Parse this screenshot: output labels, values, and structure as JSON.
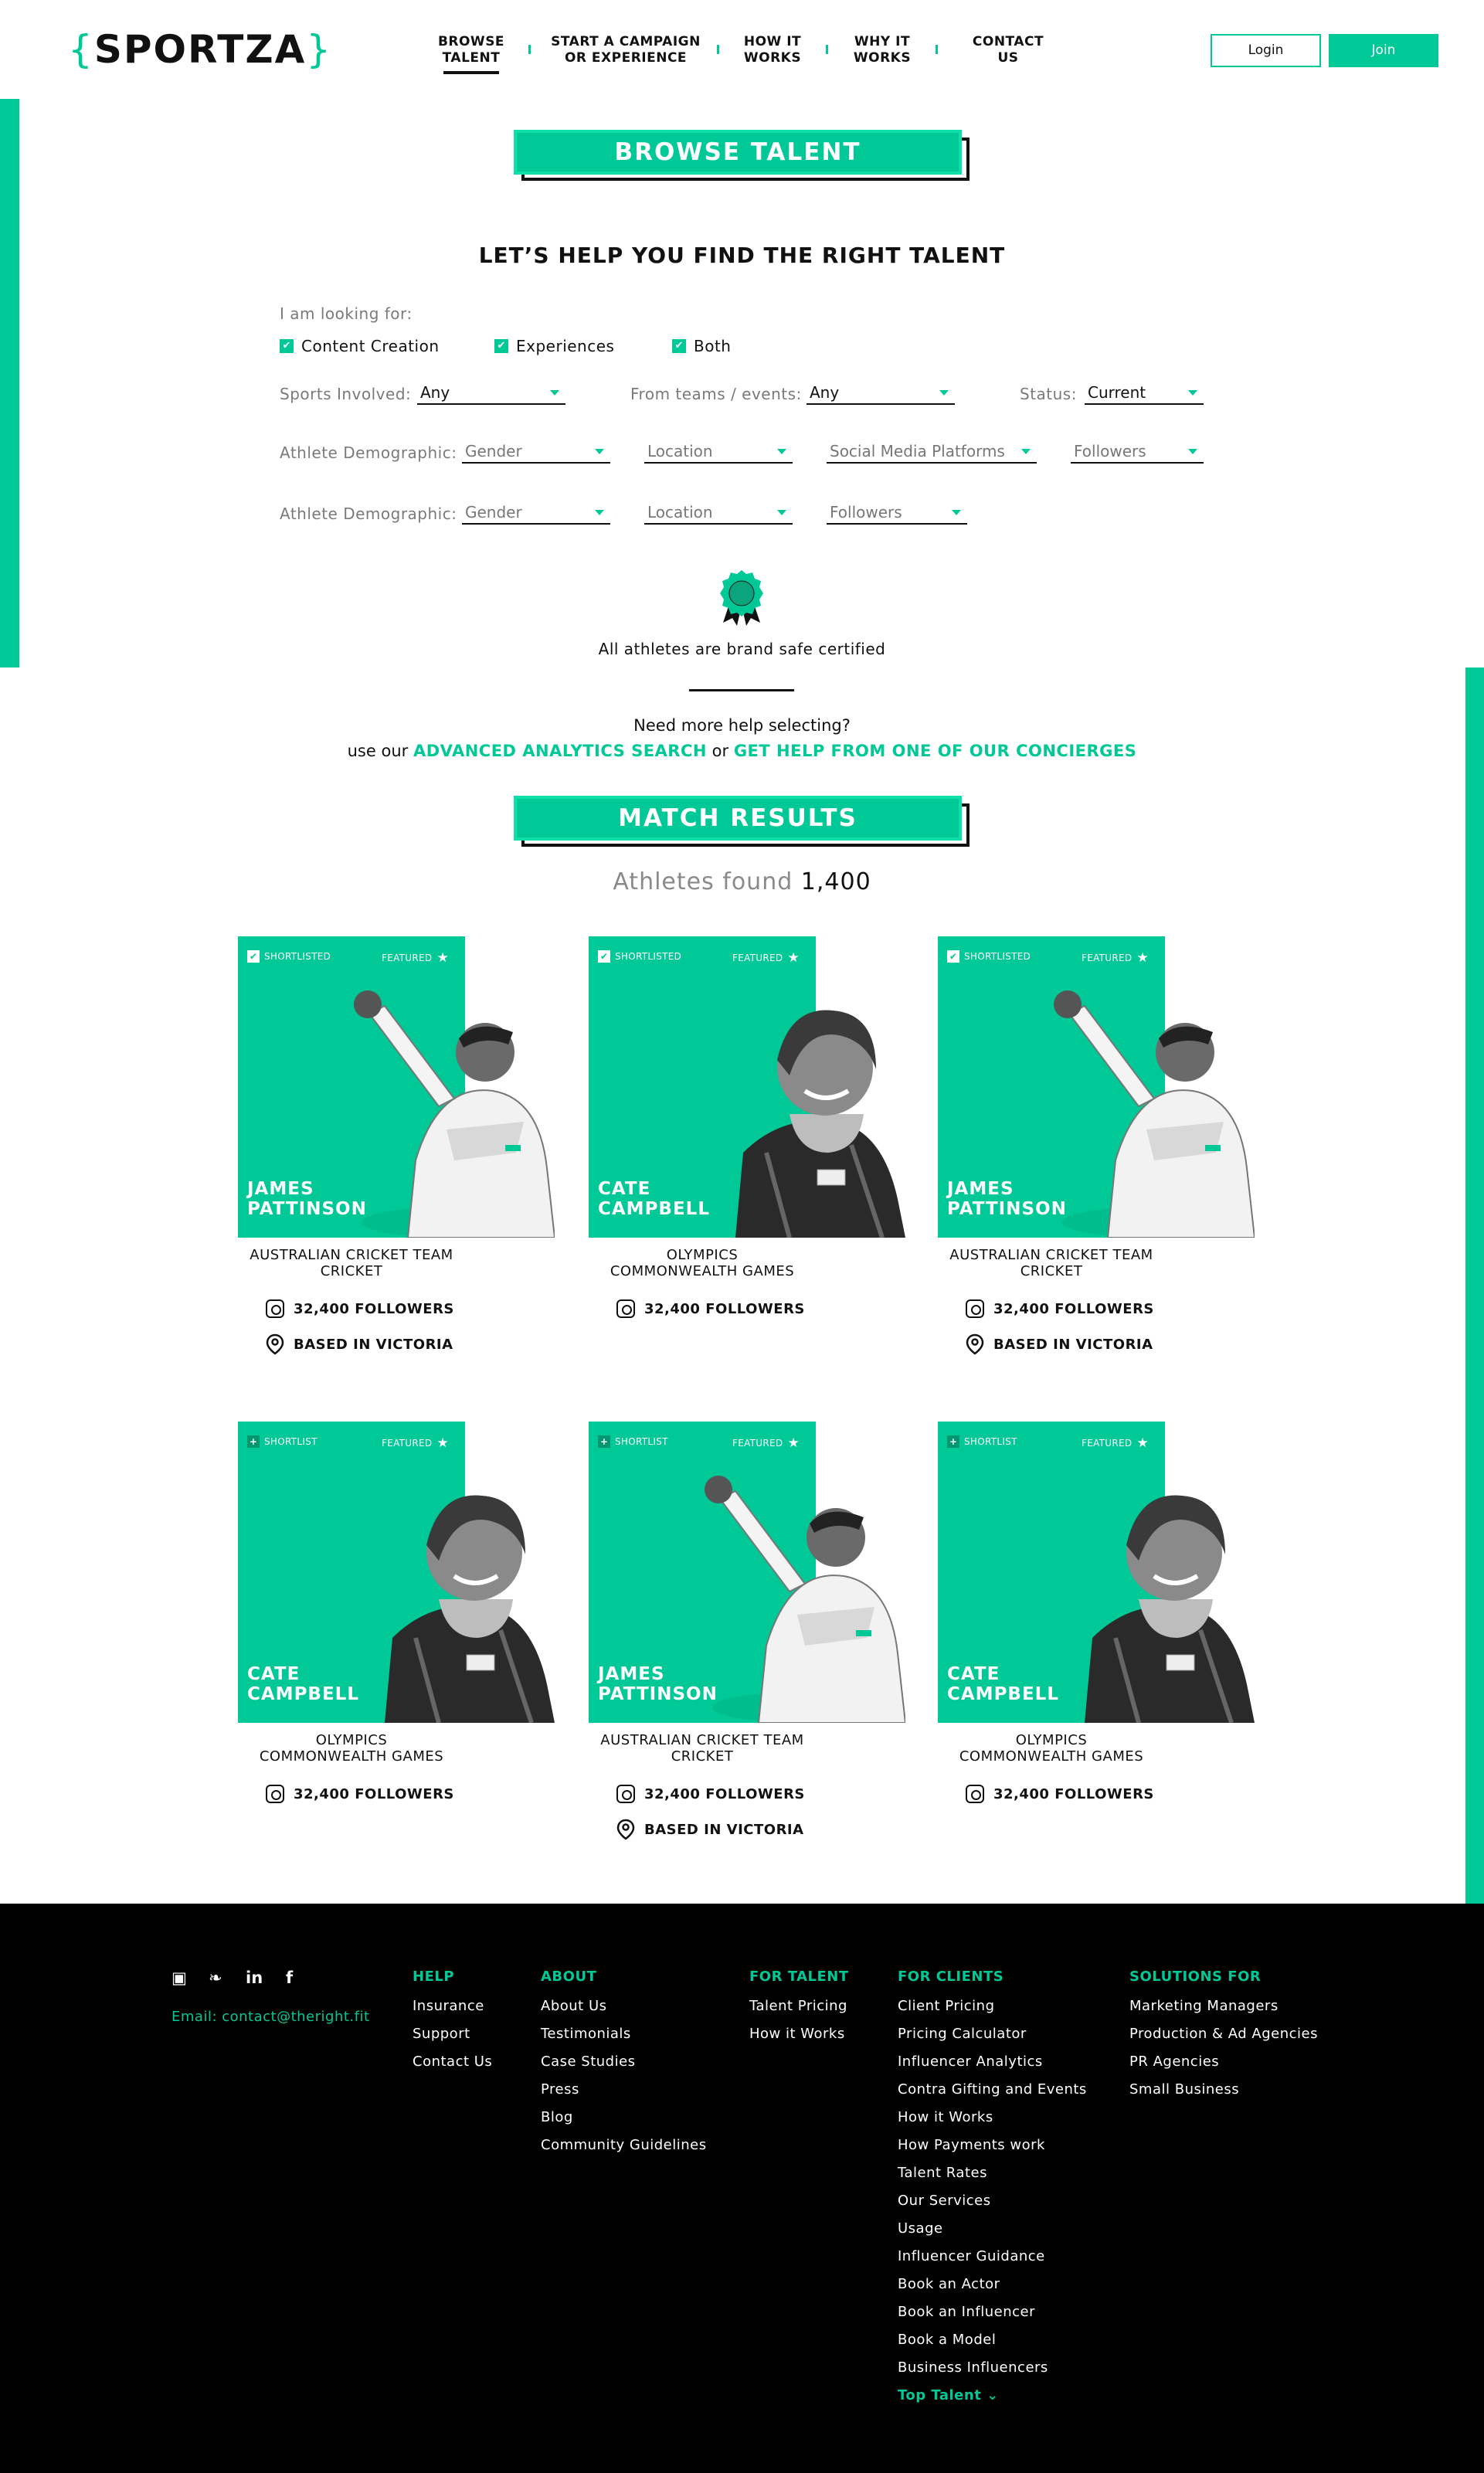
{
  "brand": {
    "logo_open": "{",
    "logo_text": "SPORTZA",
    "logo_close": "}",
    "accent_color": "#00c896"
  },
  "nav": {
    "items": [
      {
        "label": "BROWSE TALENT",
        "line1": "BROWSE",
        "line2": "TALENT"
      },
      {
        "label": "START A CAMPAIGN OR EXPERIENCE",
        "line1": "START A CAMPAIGN",
        "line2": "OR EXPERIENCE"
      },
      {
        "label": "HOW IT WORKS",
        "line1": "HOW IT",
        "line2": "WORKS"
      },
      {
        "label": "WHY IT WORKS",
        "line1": "WHY IT",
        "line2": "WORKS"
      },
      {
        "label": "CONTACT US",
        "line1": "CONTACT",
        "line2": "US"
      }
    ],
    "login": "Login",
    "join": "Join"
  },
  "browse": {
    "heading": "BROWSE TALENT",
    "subtitle": "LET’S HELP YOU FIND THE RIGHT TALENT",
    "looking_for_label": "I am looking for:",
    "options": [
      "Content Creation",
      "Experiences",
      "Both"
    ],
    "check_glyph": "✔",
    "sports_label": "Sports Involved:",
    "sports_value": "Any",
    "teams_label": "From teams / events:",
    "teams_value": "Any",
    "status_label": "Status:",
    "status_value": "Current",
    "demo_label_1": "Athlete Demographic:",
    "demo_row_1": [
      "Gender",
      "Location",
      "Social Media Platforms",
      "Followers"
    ],
    "demo_label_2": "Athlete Demographic:",
    "demo_row_2": [
      "Gender",
      "Location",
      "Followers"
    ],
    "certified_text": "All athletes are brand safe certified",
    "help_line_1": "Need more help selecting?",
    "help_prefix": "use our",
    "help_link_1": "ADVANCED ANALYTICS SEARCH",
    "help_or": "or",
    "help_link_2": "GET HELP FROM ONE OF OUR CONCIERGES"
  },
  "results": {
    "heading": "MATCH RESULTS",
    "found_label": "Athletes found",
    "found_count": "1,400",
    "cards": [
      {
        "tag": "SHORTLISTED",
        "tag_glyph": "✔",
        "featured": "FEATURED",
        "star": "★",
        "name_1": "JAMES",
        "name_2": "PATTINSON",
        "team_1": "AUSTRALIAN CRICKET TEAM",
        "team_2": "CRICKET",
        "followers": "32,400 FOLLOWERS",
        "location": "BASED IN VICTORIA",
        "photo": "cricketer"
      },
      {
        "tag": "SHORTLISTED",
        "tag_glyph": "✔",
        "featured": "FEATURED",
        "star": "★",
        "name_1": "CATE",
        "name_2": "CAMPBELL",
        "team_1": "OLYMPICS",
        "team_2": "COMMONWEALTH GAMES",
        "followers": "32,400 FOLLOWERS",
        "photo": "swimmer"
      },
      {
        "tag": "SHORTLISTED",
        "tag_glyph": "✔",
        "featured": "FEATURED",
        "star": "★",
        "name_1": "JAMES",
        "name_2": "PATTINSON",
        "team_1": "AUSTRALIAN CRICKET TEAM",
        "team_2": "CRICKET",
        "followers": "32,400 FOLLOWERS",
        "location": "BASED IN VICTORIA",
        "photo": "cricketer"
      },
      {
        "tag": "SHORTLIST",
        "tag_glyph": "+",
        "featured": "FEATURED",
        "star": "★",
        "name_1": "CATE",
        "name_2": "CAMPBELL",
        "team_1": "OLYMPICS",
        "team_2": "COMMONWEALTH GAMES",
        "followers": "32,400 FOLLOWERS",
        "photo": "swimmer"
      },
      {
        "tag": "SHORTLIST",
        "tag_glyph": "+",
        "featured": "FEATURED",
        "star": "★",
        "name_1": "JAMES",
        "name_2": "PATTINSON",
        "team_1": "AUSTRALIAN CRICKET TEAM",
        "team_2": "CRICKET",
        "followers": "32,400 FOLLOWERS",
        "location": "BASED IN VICTORIA",
        "photo": "cricketer"
      },
      {
        "tag": "SHORTLIST",
        "tag_glyph": "+",
        "featured": "FEATURED",
        "star": "★",
        "name_1": "CATE",
        "name_2": "CAMPBELL",
        "team_1": "OLYMPICS",
        "team_2": "COMMONWEALTH GAMES",
        "followers": "32,400 FOLLOWERS",
        "photo": "swimmer"
      }
    ]
  },
  "footer": {
    "social_icons": [
      "instagram-icon",
      "twitter-icon",
      "linkedin-icon",
      "facebook-icon"
    ],
    "social_glyphs": {
      "instagram": "▣",
      "twitter": "❧",
      "linkedin": "in",
      "facebook": "f"
    },
    "email": "Email: contact@theright.fit",
    "help": {
      "heading": "HELP",
      "items": [
        "Insurance",
        "Support",
        "Contact Us"
      ]
    },
    "about": {
      "heading": "ABOUT",
      "items": [
        "About Us",
        "Testimonials",
        "Case Studies",
        "Press",
        "Blog",
        "Community Guidelines"
      ]
    },
    "talent": {
      "heading": "FOR TALENT",
      "items": [
        "Talent Pricing",
        "How it Works"
      ]
    },
    "clients": {
      "heading": "FOR CLIENTS",
      "items": [
        "Client Pricing",
        "Pricing Calculator",
        "Influencer Analytics",
        "Contra Gifting and Events",
        "How it Works",
        "How Payments work",
        "Talent Rates",
        "Our Services",
        "Usage",
        "Influencer Guidance",
        "Book an Actor",
        "Book an Influencer",
        "Book a Model",
        "Business Influencers"
      ],
      "top_talent": "Top Talent",
      "chevron": "⌄"
    },
    "solutions": {
      "heading": "SOLUTIONS FOR",
      "items": [
        "Marketing Managers",
        "Production & Ad Agencies",
        "PR Agencies",
        "Small Business"
      ]
    }
  }
}
